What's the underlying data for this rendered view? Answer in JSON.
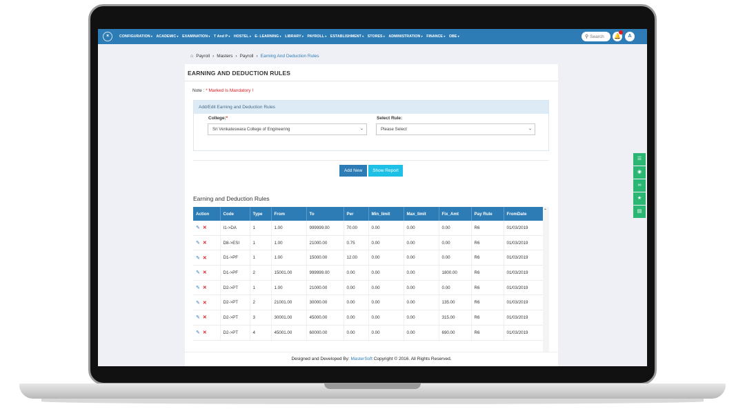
{
  "nav": {
    "logo_glyph": "✶",
    "menu": [
      "CONFIGURATION",
      "ACADEMIC",
      "EXAMINATION",
      "T And P",
      "HOSTEL",
      "E- LEARNING",
      "LIBRARY",
      "PAYROLL",
      "ESTABLISHMENT",
      "STORES",
      "ADMINISTRATION",
      "FINANCE",
      "OBE"
    ],
    "search_placeholder": "Search",
    "avatar_letter": "A"
  },
  "breadcrumb": [
    "Payroll",
    "Masters",
    "Payroll",
    "Earning And Deduction Rules"
  ],
  "page_title": "EARNING AND DEDUCTION RULES",
  "note": {
    "prefix": "Note :",
    "text": "* Marked Is Mandatory !"
  },
  "form": {
    "heading": "Add/Edit Earning and Deduction Rules",
    "college_label": "College:",
    "college_value": "Sri Venkateswara College of Engineering",
    "rule_label": "Select Rule:",
    "rule_value": "Please Select"
  },
  "buttons": {
    "add_new": "Add New",
    "show_report": "Show Report"
  },
  "table": {
    "title": "Earning and Deduction Rules",
    "columns": [
      "Action",
      "Code",
      "Type",
      "From",
      "To",
      "Per",
      "Min_limit",
      "Max_limit",
      "Fix_Amt",
      "Pay Rule",
      "FromDate"
    ],
    "rows": [
      [
        "I1->DA",
        "1",
        "1.00",
        "999999.00",
        "70.00",
        "0.00",
        "0.00",
        "0.00",
        "R6",
        "01/03/2019"
      ],
      [
        "D8->ESI",
        "1",
        "1.00",
        "21000.00",
        "0.75",
        "0.00",
        "0.00",
        "0.00",
        "R6",
        "01/03/2019"
      ],
      [
        "D1->PF",
        "1",
        "1.00",
        "15000.00",
        "12.00",
        "0.00",
        "0.00",
        "0.00",
        "R6",
        "01/03/2019"
      ],
      [
        "D1->PF",
        "2",
        "15001.00",
        "999999.00",
        "0.00",
        "0.00",
        "0.00",
        "1800.00",
        "R6",
        "01/03/2019"
      ],
      [
        "D2->PT",
        "1",
        "1.00",
        "21000.00",
        "0.00",
        "0.00",
        "0.00",
        "0.00",
        "R6",
        "01/03/2019"
      ],
      [
        "D2->PT",
        "2",
        "21001.00",
        "30000.00",
        "0.00",
        "0.00",
        "0.00",
        "135.00",
        "R6",
        "01/03/2019"
      ],
      [
        "D2->PT",
        "3",
        "30001.00",
        "45000.00",
        "0.00",
        "0.00",
        "0.00",
        "315.00",
        "R6",
        "01/03/2019"
      ],
      [
        "D2->PT",
        "4",
        "45001.00",
        "60000.00",
        "0.00",
        "0.00",
        "0.00",
        "690.00",
        "R6",
        "01/03/2019"
      ]
    ]
  },
  "footer": {
    "prefix": "Designed and Developed By:",
    "brand": "MasterSoft",
    "suffix": "Copyright © 2016. All Rights Reserved."
  },
  "side_tools": [
    "menu-icon",
    "camera-icon",
    "link-icon",
    "star-icon",
    "document-icon"
  ],
  "colors": {
    "primary": "#2d7cb6",
    "accent": "#1fc0e6",
    "danger": "#e31b23",
    "tool_green": "#2bb673"
  }
}
